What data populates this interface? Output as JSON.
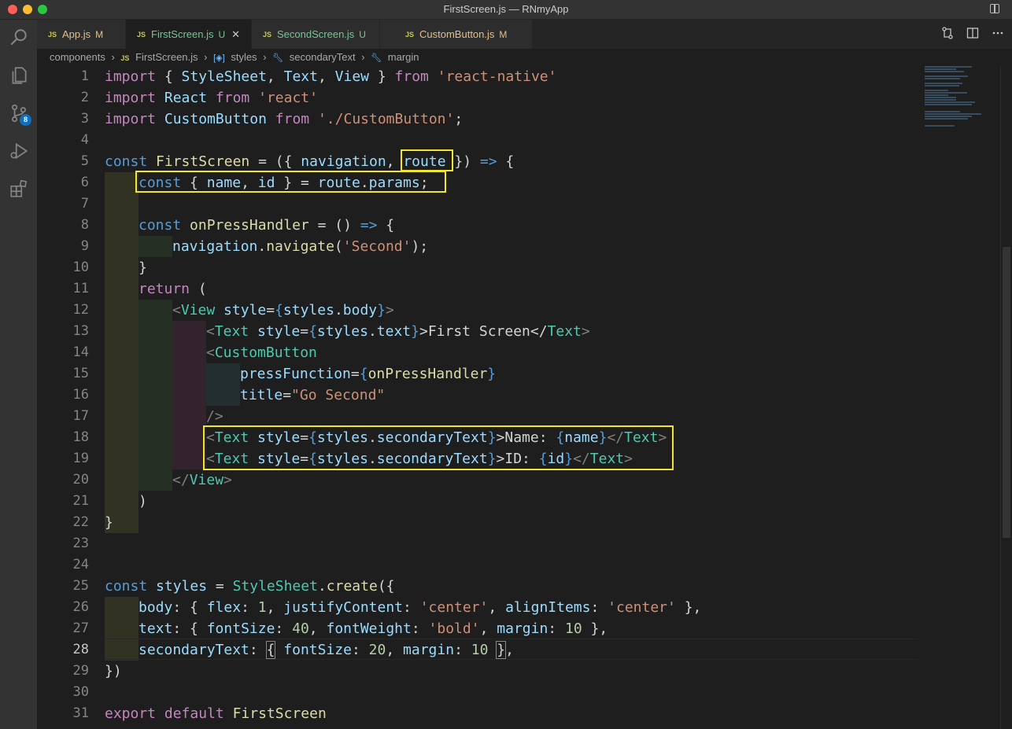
{
  "window": {
    "title": "FirstScreen.js — RNmyApp"
  },
  "activity_bar": {
    "items": [
      {
        "icon": "search-icon"
      },
      {
        "icon": "explorer-icon"
      },
      {
        "icon": "source-control-icon",
        "badge": "8"
      },
      {
        "icon": "run-debug-icon"
      },
      {
        "icon": "extensions-icon"
      }
    ]
  },
  "tabs": [
    {
      "lang": "JS",
      "label": "App.js",
      "status": "M"
    },
    {
      "lang": "JS",
      "label": "FirstScreen.js",
      "status": "U",
      "close": "✕"
    },
    {
      "lang": "JS",
      "label": "SecondScreen.js",
      "status": "U"
    },
    {
      "lang": "JS",
      "label": "CustomButton.js",
      "status": "M"
    }
  ],
  "breadcrumb": {
    "items": [
      "components",
      "FirstScreen.js",
      "styles",
      "secondaryText",
      "margin"
    ],
    "lang": "JS",
    "sep": "›"
  },
  "editor": {
    "current_line": 28,
    "line_numbers": [
      "1",
      "2",
      "3",
      "4",
      "5",
      "6",
      "7",
      "8",
      "9",
      "10",
      "11",
      "12",
      "13",
      "14",
      "15",
      "16",
      "17",
      "18",
      "19",
      "20",
      "21",
      "22",
      "23",
      "24",
      "25",
      "26",
      "27",
      "28",
      "29",
      "30",
      "31"
    ],
    "code": {
      "l1": [
        "import",
        " { ",
        "StyleSheet",
        ", ",
        "Text",
        ", ",
        "View",
        " } ",
        "from",
        " ",
        "'react-native'"
      ],
      "l2": [
        "import",
        " ",
        "React",
        " ",
        "from",
        " ",
        "'react'"
      ],
      "l3": [
        "import",
        " ",
        "CustomButton",
        " ",
        "from",
        " ",
        "'./CustomButton'",
        ";"
      ],
      "l5": [
        "const",
        " ",
        "FirstScreen",
        " = ({ ",
        "navigation",
        ", ",
        "route",
        " }) ",
        "=>",
        " {"
      ],
      "l6": [
        "const",
        " { ",
        "name",
        ", ",
        "id",
        " } = ",
        "route",
        ".",
        "params",
        ";"
      ],
      "l8": [
        "const",
        " ",
        "onPressHandler",
        " = () ",
        "=>",
        " {"
      ],
      "l9": [
        "navigation",
        ".",
        "navigate",
        "(",
        "'Second'",
        ");"
      ],
      "l10": [
        "}"
      ],
      "l11": [
        "return",
        " ("
      ],
      "l12": [
        "<",
        "View",
        " ",
        "style",
        "=",
        "{",
        "styles",
        ".",
        "body",
        "}",
        ">"
      ],
      "l13": [
        "<",
        "Text",
        " ",
        "style",
        "=",
        "{",
        "styles",
        ".",
        "text",
        "}",
        ">First Screen</",
        "Text",
        ">"
      ],
      "l14": [
        "<",
        "CustomButton"
      ],
      "l15": [
        "pressFunction",
        "=",
        "{",
        "onPressHandler",
        "}"
      ],
      "l16": [
        "title",
        "=",
        "\"Go Second\""
      ],
      "l17": [
        "/>"
      ],
      "l18": [
        "<",
        "Text",
        " ",
        "style",
        "=",
        "{",
        "styles",
        ".",
        "secondaryText",
        "}",
        ">Name: ",
        "{",
        "name",
        "}",
        "</",
        "Text",
        ">"
      ],
      "l19": [
        "<",
        "Text",
        " ",
        "style",
        "=",
        "{",
        "styles",
        ".",
        "secondaryText",
        "}",
        ">ID: ",
        "{",
        "id",
        "}",
        "</",
        "Text",
        ">"
      ],
      "l20": [
        "</",
        "View",
        ">"
      ],
      "l21": [
        ")"
      ],
      "l22": [
        "}"
      ],
      "l25": [
        "const",
        " ",
        "styles",
        " = ",
        "StyleSheet",
        ".",
        "create",
        "({"
      ],
      "l26": [
        "body",
        ": { ",
        "flex",
        ": ",
        "1",
        ", ",
        "justifyContent",
        ": ",
        "'center'",
        ", ",
        "alignItems",
        ": ",
        "'center'",
        " },"
      ],
      "l27": [
        "text",
        ": { ",
        "fontSize",
        ": ",
        "40",
        ", ",
        "fontWeight",
        ": ",
        "'bold'",
        ", ",
        "margin",
        ": ",
        "10",
        " },"
      ],
      "l28": [
        "secondaryText",
        ": ",
        "{",
        " ",
        "fontSize",
        ": ",
        "20",
        ", ",
        "margin",
        ": ",
        "10",
        " ",
        "}",
        ","
      ],
      "l29": [
        "})"
      ],
      "l31": [
        "export",
        " ",
        "default",
        " ",
        "FirstScreen"
      ]
    }
  },
  "colors": {
    "highlight_box": "#f0e632",
    "keyword": "#569cd6",
    "control": "#c586c0",
    "string": "#ce9178",
    "tag": "#4ec9b0"
  }
}
